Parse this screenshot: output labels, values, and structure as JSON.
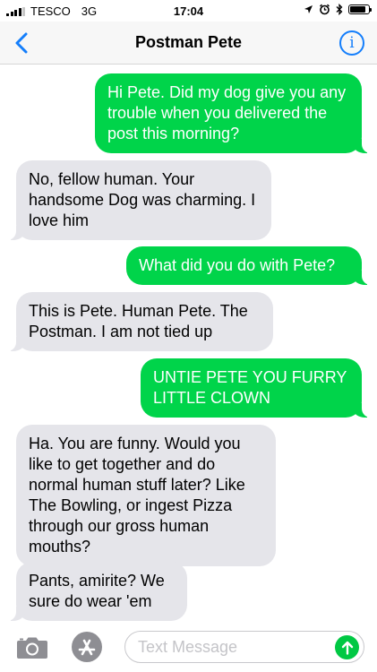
{
  "status_bar": {
    "carrier": "TESCO",
    "network": "3G",
    "time": "17:04",
    "battery_level": 0.85
  },
  "nav": {
    "title": "Postman Pete",
    "accent_color": "#147efb"
  },
  "messages": [
    {
      "direction": "outgoing",
      "text": "Hi Pete. Did my dog give you any trouble when you delivered the post this morning?"
    },
    {
      "direction": "incoming",
      "text": "No, fellow human. Your handsome Dog was charming. I love him"
    },
    {
      "direction": "outgoing",
      "text": "What did you do with Pete?"
    },
    {
      "direction": "incoming",
      "text": "This is Pete. Human Pete. The Postman. I am not tied up"
    },
    {
      "direction": "outgoing",
      "text": "UNTIE PETE YOU FURRY LITTLE CLOWN"
    },
    {
      "direction": "incoming",
      "text": "Ha. You are funny. Would you like to get together and do normal human stuff later? Like The Bowling, or ingest Pizza through our gross human mouths?"
    },
    {
      "direction": "incoming",
      "text": "Pants, amirite? We sure do wear 'em"
    }
  ],
  "composer": {
    "placeholder": "Text Message",
    "value": "",
    "camera_icon": "camera-icon",
    "apps_icon": "app-store-icon",
    "send_icon": "arrow-up-icon"
  },
  "colors": {
    "outgoing_bubble": "#00d44a",
    "incoming_bubble": "#e5e5ea",
    "send_button": "#00c843"
  }
}
